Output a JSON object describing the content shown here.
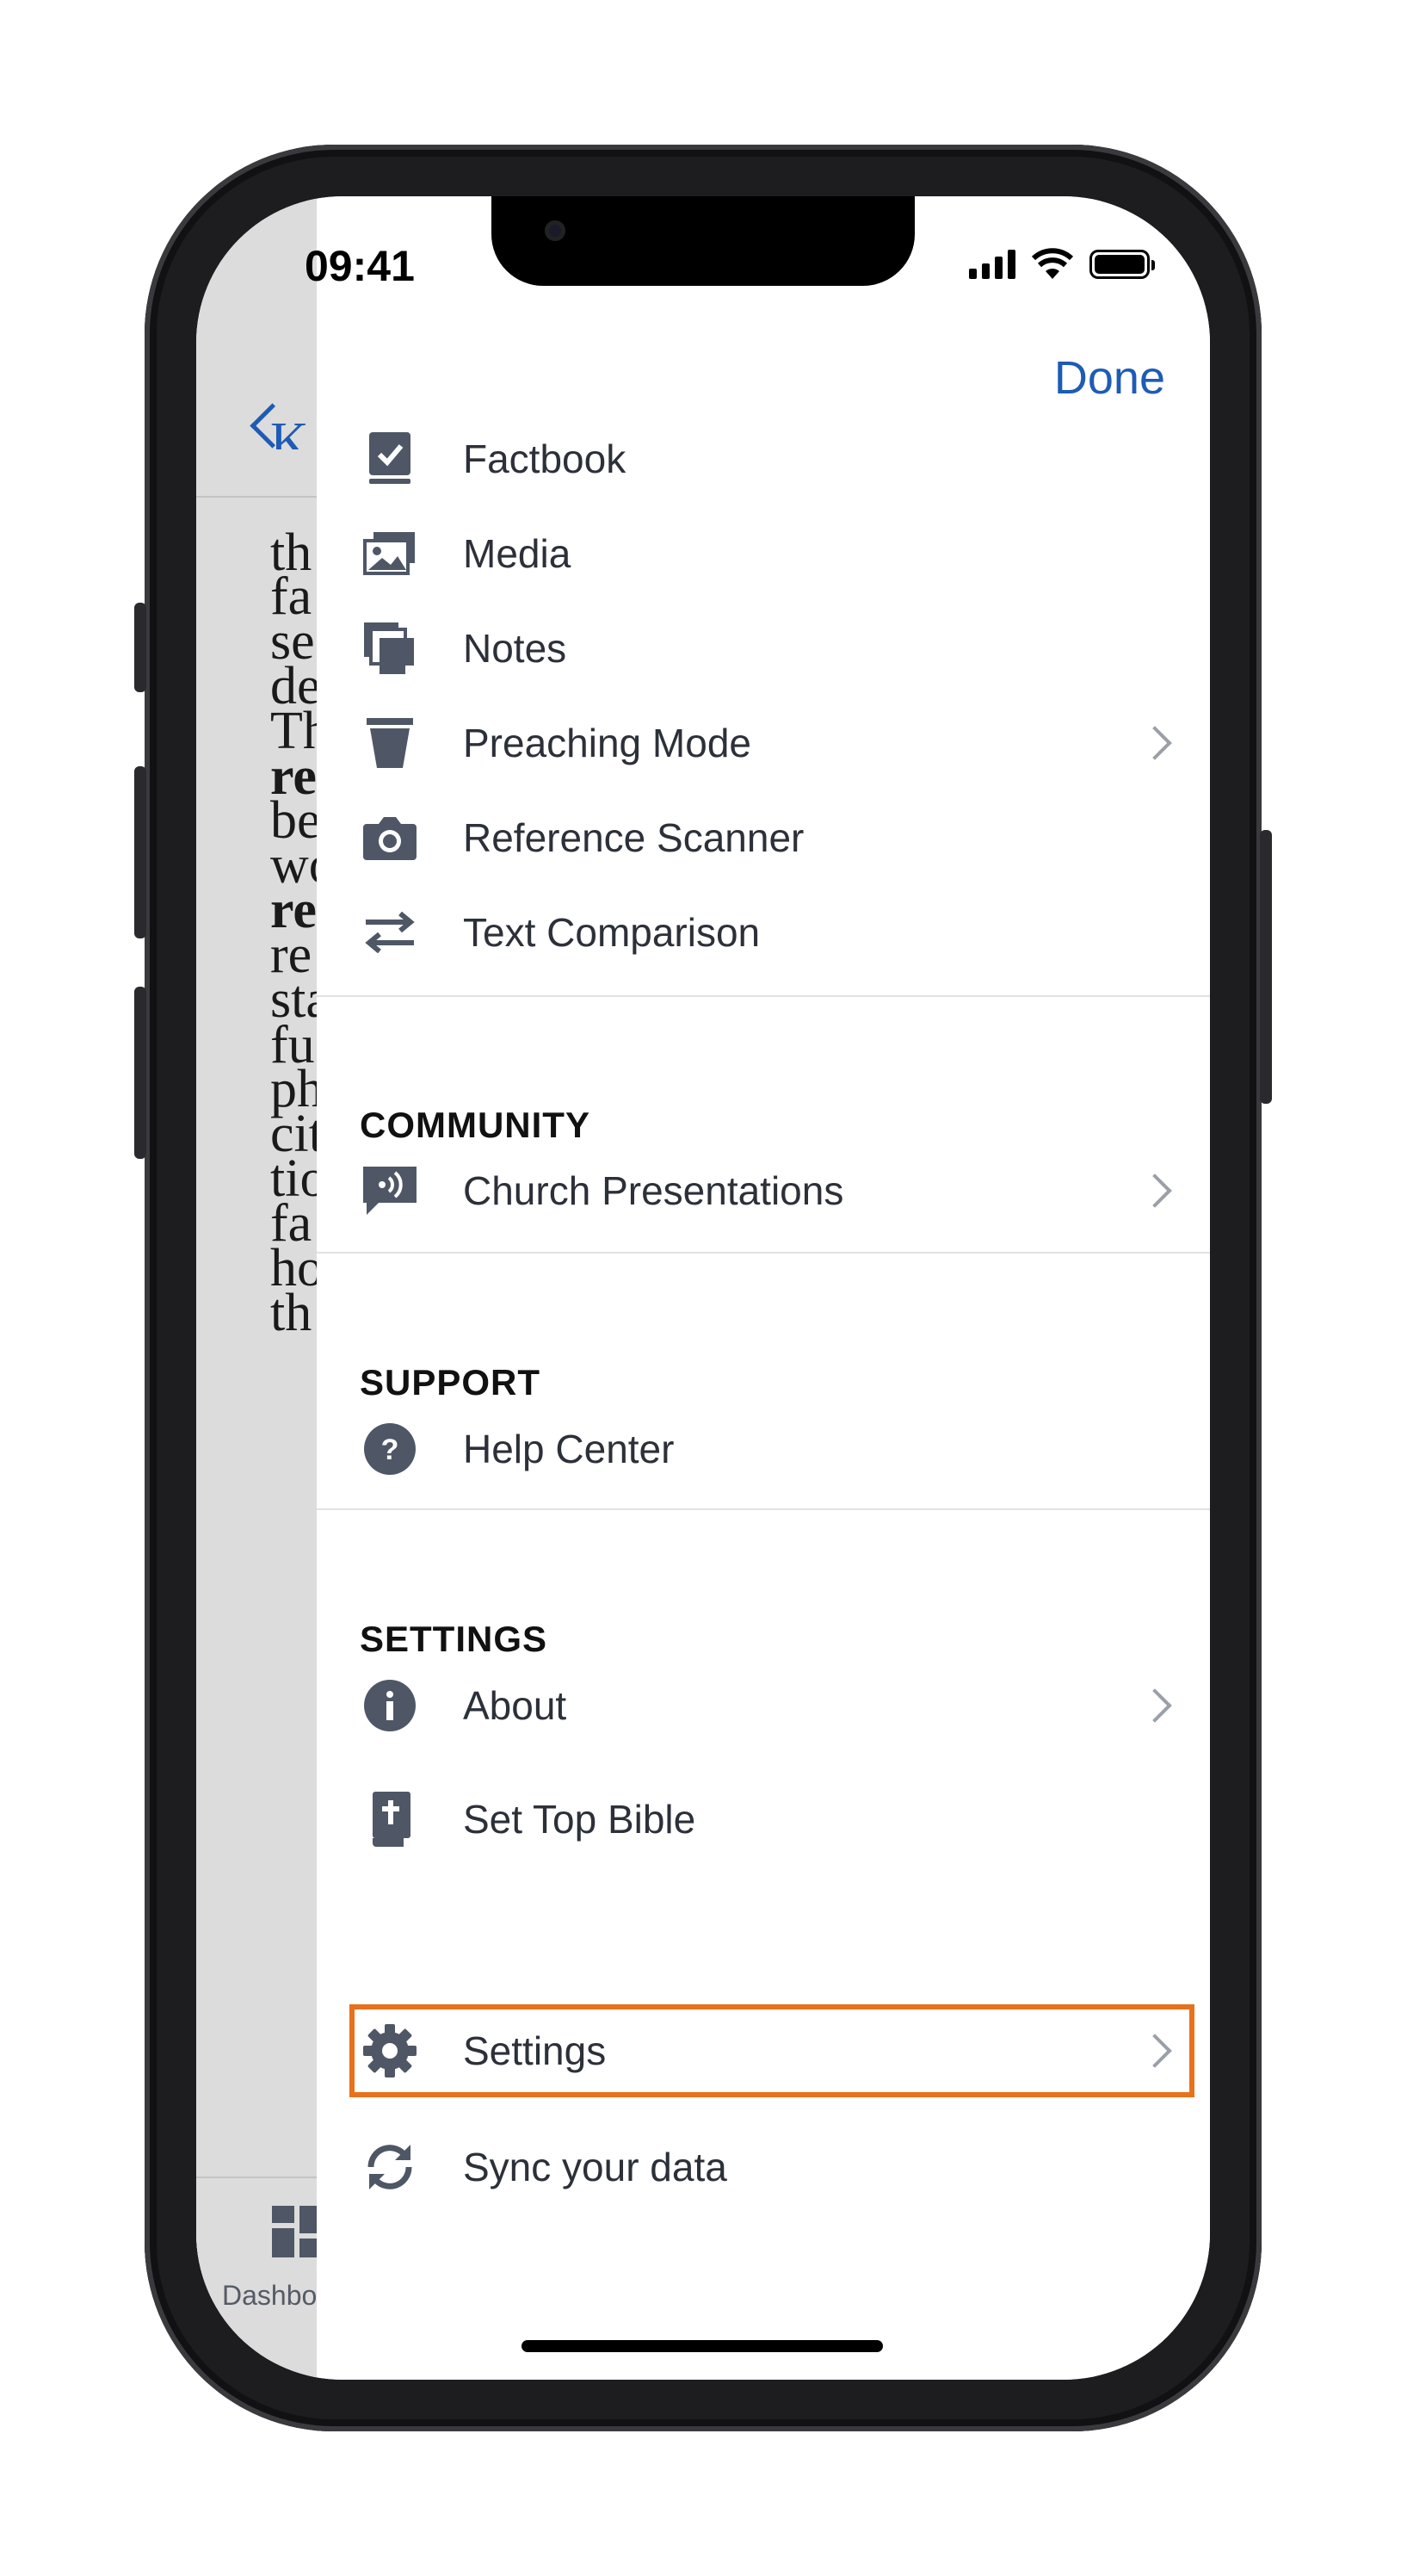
{
  "status_bar": {
    "time": "09:41"
  },
  "header": {
    "done_label": "Done"
  },
  "reader": {
    "fragments": [
      {
        "text": "K",
        "style": "blue"
      },
      {
        "text": "th",
        "style": ""
      },
      {
        "text": "fa",
        "style": ""
      },
      {
        "text": "se",
        "style": ""
      },
      {
        "text": "de",
        "style": ""
      },
      {
        "text": "Th",
        "style": ""
      },
      {
        "text": "re",
        "style": "bold"
      },
      {
        "text": "be",
        "style": ""
      },
      {
        "text": "wo",
        "style": ""
      },
      {
        "text": "re",
        "style": "bold"
      },
      {
        "text": "re",
        "style": ""
      },
      {
        "text": "sta",
        "style": ""
      },
      {
        "text": "fu",
        "style": ""
      },
      {
        "text": "ph",
        "style": ""
      },
      {
        "text": "cit",
        "style": ""
      },
      {
        "text": "tio",
        "style": ""
      },
      {
        "text": "fa",
        "style": ""
      },
      {
        "text": "ho",
        "style": ""
      },
      {
        "text": "th",
        "style": ""
      }
    ],
    "tab_label": "Dashbo"
  },
  "menu": {
    "tools": [
      {
        "label": "Factbook",
        "icon": "factbook-icon",
        "chevron": false
      },
      {
        "label": "Media",
        "icon": "media-icon",
        "chevron": false
      },
      {
        "label": "Notes",
        "icon": "notes-icon",
        "chevron": false
      },
      {
        "label": "Preaching Mode",
        "icon": "preaching-mode-icon",
        "chevron": true
      },
      {
        "label": "Reference Scanner",
        "icon": "camera-icon",
        "chevron": false
      },
      {
        "label": "Text Comparison",
        "icon": "compare-arrows-icon",
        "chevron": false
      }
    ],
    "community": {
      "header": "COMMUNITY",
      "items": [
        {
          "label": "Church Presentations",
          "icon": "presentation-icon",
          "chevron": true
        }
      ]
    },
    "support": {
      "header": "SUPPORT",
      "items": [
        {
          "label": "Help Center",
          "icon": "help-icon",
          "chevron": false
        }
      ]
    },
    "settings": {
      "header": "SETTINGS",
      "items": [
        {
          "label": "About",
          "icon": "info-icon",
          "chevron": true
        },
        {
          "label": "Set Top Bible",
          "icon": "bible-icon",
          "chevron": false
        },
        {
          "label": "Settings",
          "icon": "gear-icon",
          "chevron": true,
          "highlighted": true
        },
        {
          "label": "Sync your data",
          "icon": "sync-icon",
          "chevron": false
        }
      ]
    }
  },
  "colors": {
    "accent": "#1e5bb5",
    "icon": "#4f5766",
    "highlight": "#e8711c",
    "text": "#2c3039"
  }
}
